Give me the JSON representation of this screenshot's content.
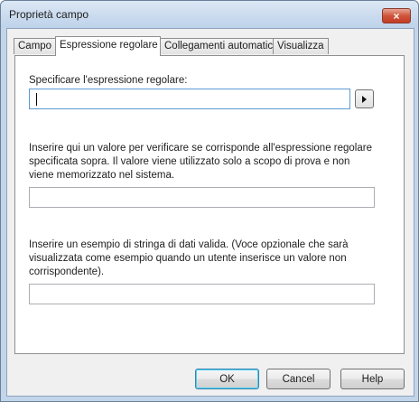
{
  "window": {
    "title": "Proprietà campo",
    "close_icon": "×"
  },
  "tabs": [
    {
      "label": "Campo"
    },
    {
      "label": "Espressione regolare",
      "active": true
    },
    {
      "label": "Collegamenti automatici"
    },
    {
      "label": "Visualizza"
    }
  ],
  "panel": {
    "regex_label": "Specificare l'espressione regolare:",
    "regex_value": "",
    "test_description": [
      "Inserire qui un valore per verificare se corrisponde all'espressione regolare",
      "specificata sopra. Il valore viene utilizzato solo a scopo di prova e non",
      "viene memorizzato nel sistema."
    ],
    "test_value": "",
    "example_description": [
      "Inserire un esempio di stringa di dati valida. (Voce opzionale che sarà",
      "visualizzata come esempio quando un utente inserisce un valore non",
      "corrispondente)."
    ],
    "example_value": ""
  },
  "buttons": {
    "ok": "OK",
    "cancel": "Cancel",
    "help": "Help"
  }
}
